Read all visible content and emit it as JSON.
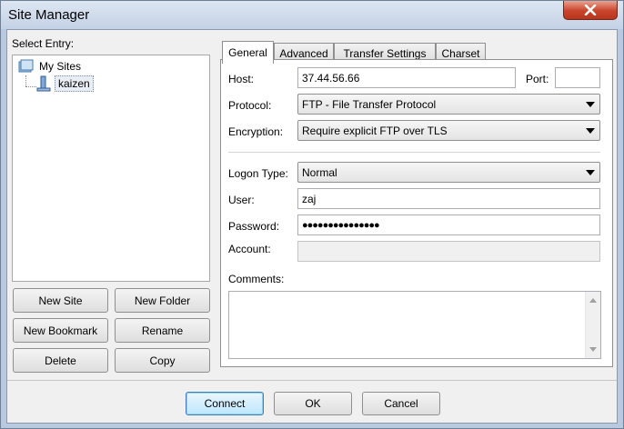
{
  "window": {
    "title": "Site Manager"
  },
  "select_entry": {
    "label": "Select Entry:",
    "tree": [
      {
        "label": "My Sites",
        "icon": "folder-icon"
      },
      {
        "label": "kaizen",
        "icon": "server-icon",
        "selected": true
      }
    ]
  },
  "entry_buttons": {
    "new_site": "New Site",
    "new_folder": "New Folder",
    "new_bookmark": "New Bookmark",
    "rename": "Rename",
    "delete": "Delete",
    "copy": "Copy"
  },
  "tabs": [
    "General",
    "Advanced",
    "Transfer Settings",
    "Charset"
  ],
  "active_tab": "General",
  "general": {
    "host_label": "Host:",
    "host_value": "37.44.56.66",
    "port_label": "Port:",
    "port_value": "",
    "protocol_label": "Protocol:",
    "protocol_value": "FTP - File Transfer Protocol",
    "encryption_label": "Encryption:",
    "encryption_value": "Require explicit FTP over TLS",
    "logon_type_label": "Logon Type:",
    "logon_type_value": "Normal",
    "user_label": "User:",
    "user_value": "zaj",
    "password_label": "Password:",
    "password_value": "●●●●●●●●●●●●●●●",
    "account_label": "Account:",
    "account_value": "",
    "comments_label": "Comments:",
    "comments_value": ""
  },
  "footer_buttons": {
    "connect": "Connect",
    "ok": "OK",
    "cancel": "Cancel"
  },
  "colors": {
    "close_button": "#c8442a",
    "default_button_border": "#3c7fb1",
    "titlebar": "#c4d2e6"
  }
}
